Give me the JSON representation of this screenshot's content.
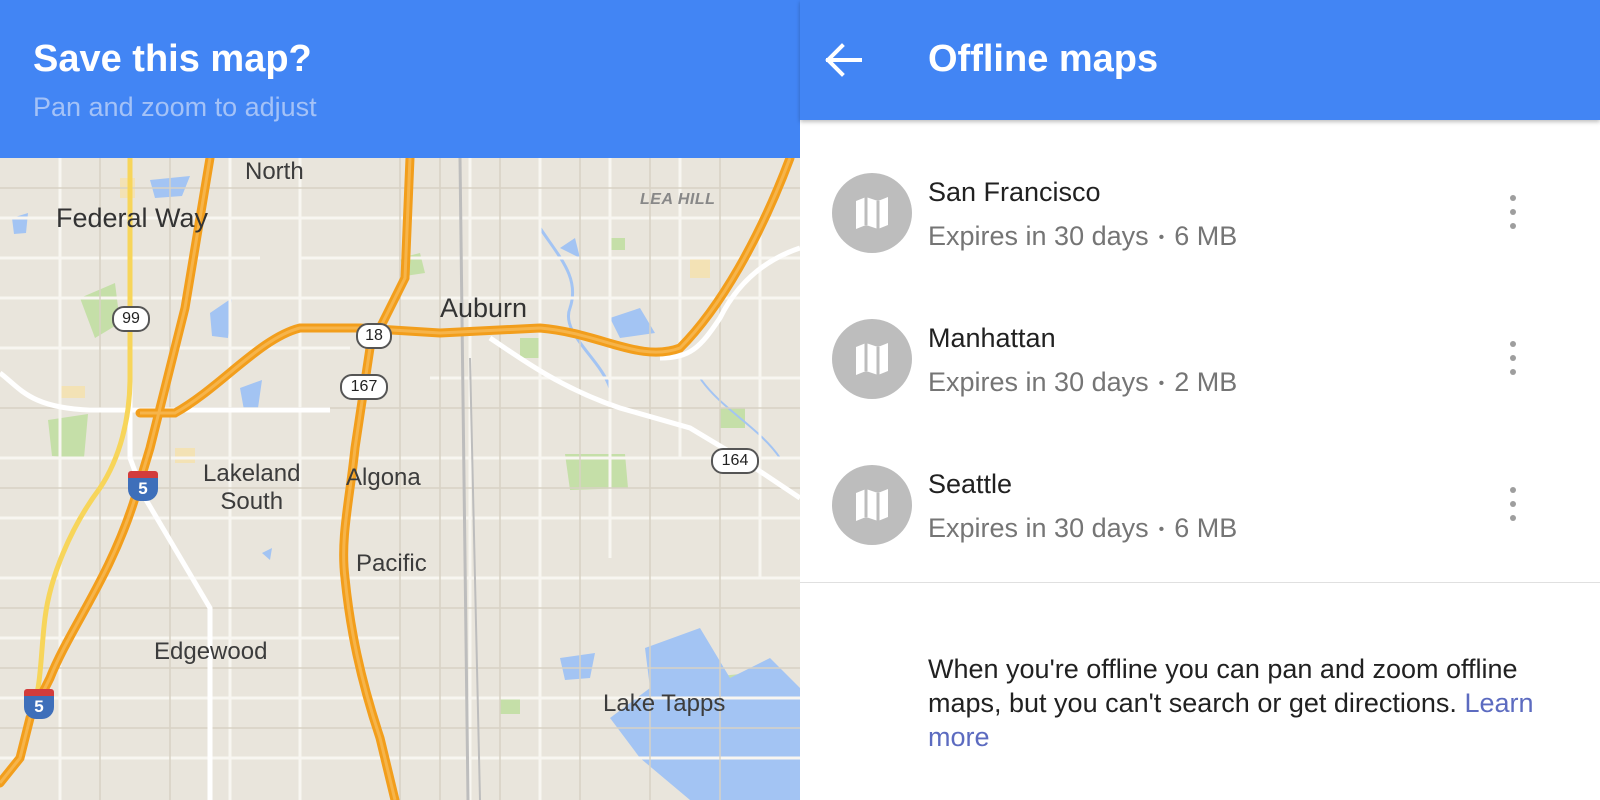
{
  "left": {
    "title": "Save this map?",
    "subtitle": "Pan and zoom to adjust",
    "places": {
      "north": "North",
      "federal_way": "Federal Way",
      "lea_hill": "LEA HILL",
      "auburn": "Auburn",
      "lakeland_south": "Lakeland\nSouth",
      "algona": "Algona",
      "pacific": "Pacific",
      "edgewood": "Edgewood",
      "lake_tapps": "Lake Tapps"
    },
    "shields": {
      "r99": "99",
      "r18": "18",
      "r167": "167",
      "r164": "164",
      "i5_a": "5",
      "i5_b": "5"
    }
  },
  "right": {
    "title": "Offline maps",
    "items": [
      {
        "name": "San Francisco",
        "expires": "Expires in 30 days",
        "size": "6 MB"
      },
      {
        "name": "Manhattan",
        "expires": "Expires in 30 days",
        "size": "2 MB"
      },
      {
        "name": "Seattle",
        "expires": "Expires in 30 days",
        "size": "6 MB"
      }
    ],
    "separator": "•",
    "info_text": "When you're offline you can pan and zoom offline maps, but you can't search or get directions.",
    "learn_more": "Learn more"
  },
  "colors": {
    "header_blue": "#4285f4",
    "highway_orange": "#f29e1c",
    "map_bg": "#e9e5dc",
    "water": "#9fc1f0",
    "park": "#b7d99a",
    "link": "#5c6bc0"
  }
}
